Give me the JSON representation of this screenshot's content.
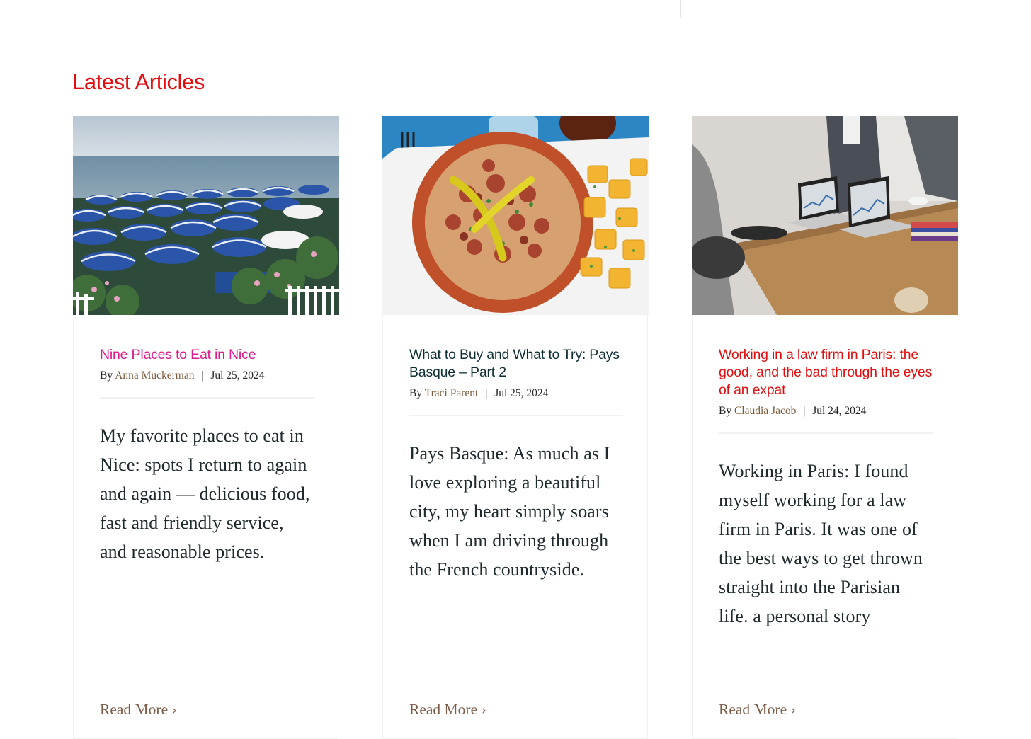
{
  "section": {
    "title": "Latest Articles",
    "title_color": "#e00e0e"
  },
  "articles": [
    {
      "title": "Nine Places to Eat in Nice",
      "title_color": "#e0188a",
      "by": "By",
      "author": "Anna Muckerman",
      "separator": "|",
      "date": "Jul 25, 2024",
      "excerpt": "My favorite places to eat in Nice: spots I return to again and again — delicious food, fast and friendly service, and reasonable prices.",
      "read_more": "Read More",
      "image": "beach-umbrellas-photo"
    },
    {
      "title": "What to Buy and What to Try: Pays Basque – Part 2",
      "title_color": "#0e2f35",
      "by": "By",
      "author": "Traci Parent",
      "separator": "|",
      "date": "Jul 25, 2024",
      "excerpt": "Pays Basque: As much as I love exploring a beautiful city, my heart simply soars when I am driving through the French countryside.",
      "read_more": "Read More",
      "image": "basque-food-photo"
    },
    {
      "title": "Working in a law firm in Paris: the good, and the bad through the eyes of an expat",
      "title_color": "#e00e0e",
      "by": "By",
      "author": "Claudia Jacob",
      "separator": "|",
      "date": "Jul 24, 2024",
      "excerpt": "Working in Paris: I found myself working for a law firm in Paris. It was one of the best ways to get thrown straight into the Parisian life. a personal story",
      "read_more": "Read More",
      "image": "office-meeting-photo"
    }
  ],
  "icons": {
    "read_more": "chevron-right-icon",
    "chevron_glyph": "›"
  }
}
